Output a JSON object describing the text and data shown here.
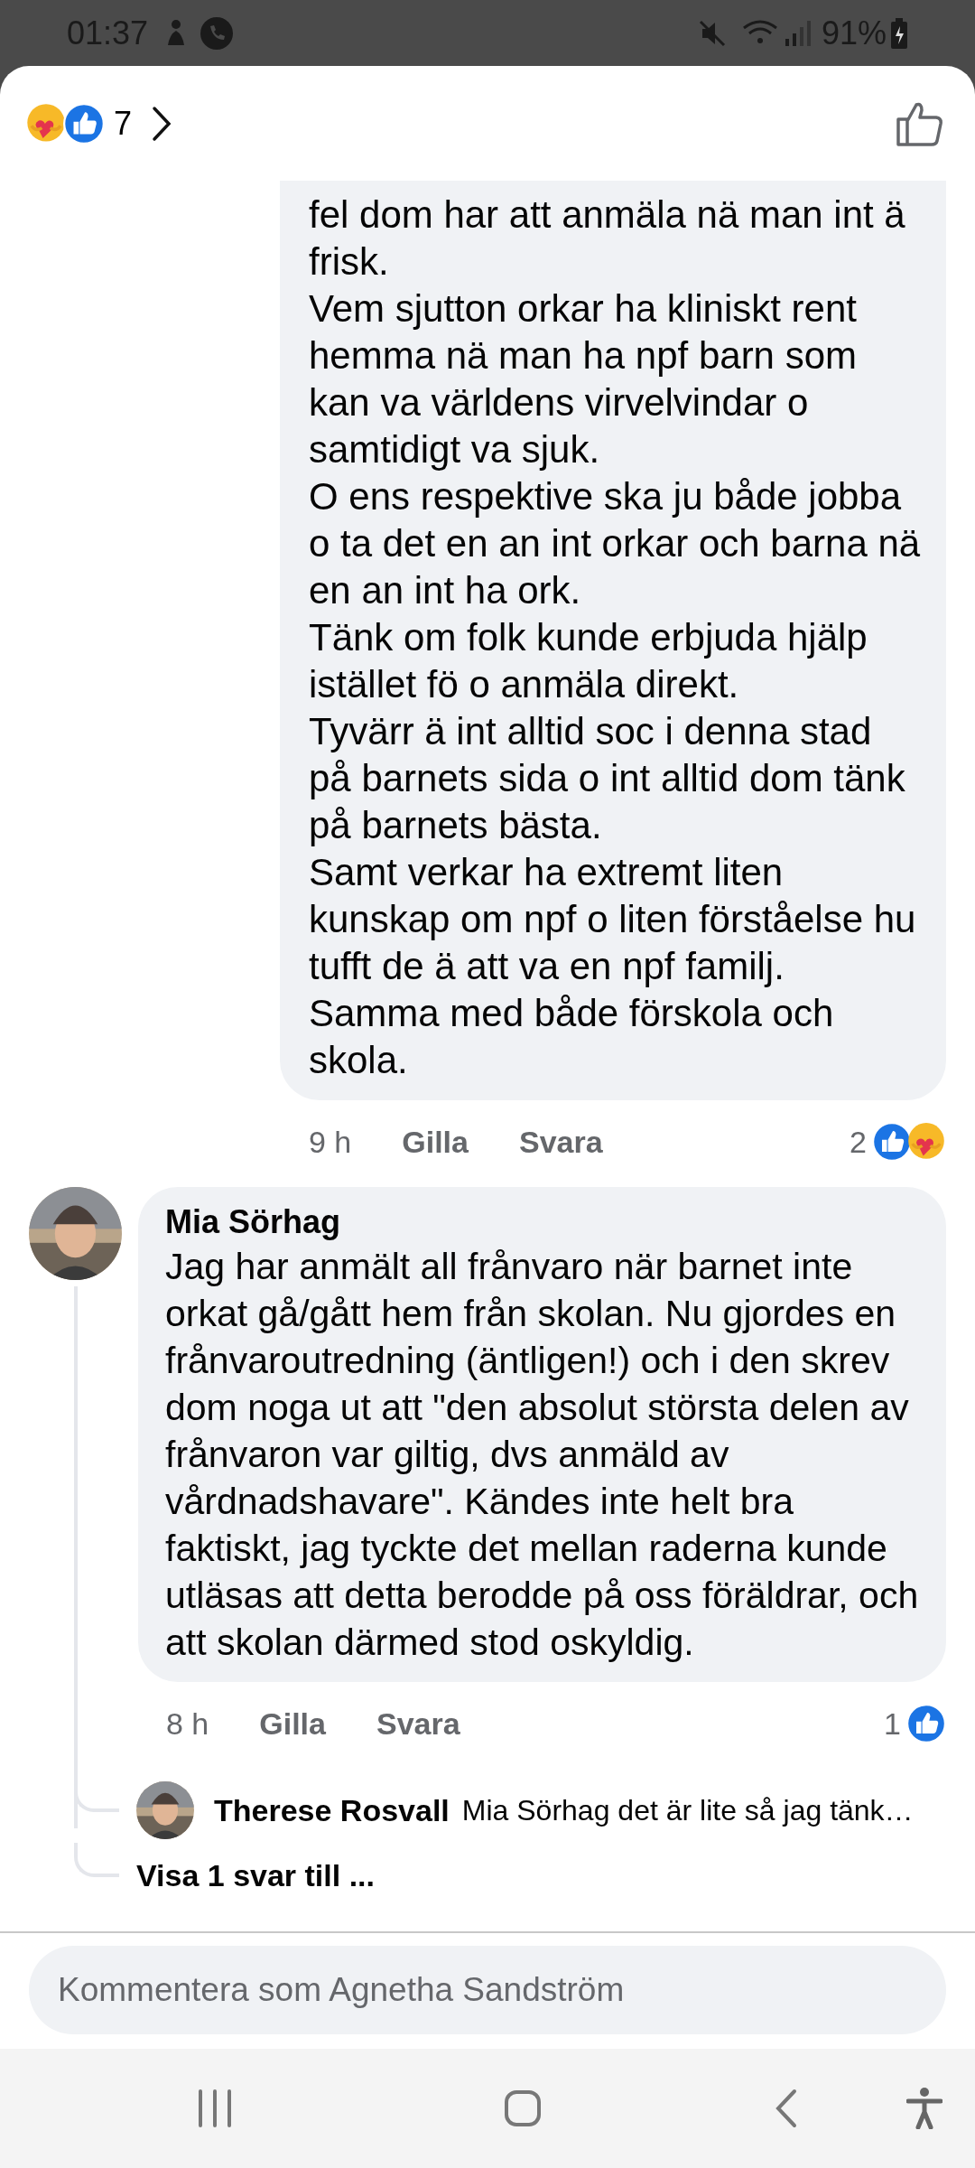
{
  "status_bar": {
    "time": "01:37",
    "battery": "91%"
  },
  "header": {
    "reactions": [
      {
        "kind": "care"
      },
      {
        "kind": "like"
      }
    ],
    "reaction_count": "7"
  },
  "comments": [
    {
      "kind": "continuation",
      "text": "fel dom har att anmäla nä man int ä frisk.\nVem sjutton orkar ha kliniskt rent hemma nä man ha npf barn som kan va världens virvelvindar o samtidigt va sjuk.\nO ens respektive ska ju både jobba o ta det en an int orkar och barna nä en an int ha ork.\nTänk om folk kunde erbjuda hjälp istället fö o anmäla direkt.\nTyvärr ä int alltid soc i denna stad på barnets sida o int alltid dom tänk på barnets bästa.\nSamt verkar ha extremt liten kunskap om npf o liten förståelse hu tufft de ä att va en npf familj.\nSamma med både förskola och skola.",
      "time": "9 h",
      "like": "Gilla",
      "reply": "Svara",
      "reaction_count": "2",
      "reactions": [
        {
          "kind": "like"
        },
        {
          "kind": "care"
        }
      ]
    },
    {
      "kind": "comment",
      "author": "Mia Sörhag",
      "text": "Jag har anmält all frånvaro när barnet inte orkat gå/gått hem från skolan. Nu gjordes en frånvaroutredning (äntligen!) och i den skrev dom noga ut att \"den absolut största delen av frånvaron var giltig, dvs anmäld av vårdnadshavare\". Kändes inte helt bra faktiskt, jag tyckte det mellan raderna kunde utläsas att detta berodde på oss föräldrar, och att skolan därmed stod oskyldig.",
      "time": "8 h",
      "like": "Gilla",
      "reply": "Svara",
      "reaction_count": "1",
      "reactions": [
        {
          "kind": "like"
        }
      ],
      "replies": [
        {
          "author": "Therese Rosvall",
          "text": "Mia Sörhag det är lite så jag tänk…"
        }
      ],
      "more_replies": "Visa 1 svar till ..."
    }
  ],
  "composer": {
    "placeholder": "Kommentera som Agnetha Sandström"
  }
}
